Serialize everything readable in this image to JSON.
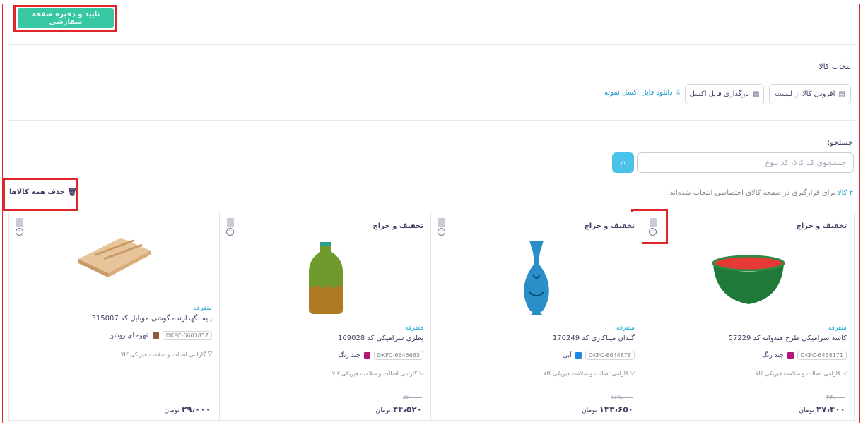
{
  "toolbar": {
    "save_label": "تایید و ذخیره صفحه سفارشی"
  },
  "select_section": {
    "title": "انتخاب کالا",
    "add_from_list": "افزودن کالا از لیست",
    "upload_excel": "بارگذاری فایل اکسل",
    "download_sample": "دانلود فایل اکسل نمونه"
  },
  "search": {
    "label": "جستجو:",
    "placeholder": "جستجوی کد کالا، کد تنوع"
  },
  "list_header": {
    "count": "۴ کالا",
    "count_text": "برای قرارگیری در صفحه کالای اختصاصی انتخاب شده‌اند.",
    "delete_all": "حذف همه کالاها"
  },
  "products": [
    {
      "badge": "تخفیف و حراج",
      "category": "متفرقه",
      "title": "کاسه سرامیکی طرح هندوانه کد 57229",
      "dkpc": "DKPC-6458171",
      "color_name": "چند رنگ",
      "color": "#b5157a",
      "guarantee": "گارانتی اصالت و سلامت فیزیکی کالا",
      "old_price": "۴۴،۰۰۰",
      "price": "۳۷،۴۰۰",
      "currency": "تومان"
    },
    {
      "badge": "تخفیف و حراج",
      "category": "متفرقه",
      "title": "گلدان میناکاری کد 170249",
      "dkpc": "DKPC-6644878",
      "color_name": "آبی",
      "color": "#1e88e5",
      "guarantee": "گارانتی اصالت و سلامت فیزیکی کالا",
      "old_price": "۱۶۹،۰۰۰",
      "price": "۱۴۳،۶۵۰",
      "currency": "تومان"
    },
    {
      "badge": "تخفیف و حراج",
      "category": "متفرقه",
      "title": "بطری سرامیکی کد 169028",
      "dkpc": "DKPC-6645663",
      "color_name": "چند رنگ",
      "color": "#b5157a",
      "guarantee": "گارانتی اصالت و سلامت فیزیکی کالا",
      "old_price": "۵۲،۰۰۰",
      "price": "۴۴،۵۲۰",
      "currency": "تومان"
    },
    {
      "badge": "",
      "category": "متفرقه",
      "title": "پایه نگهدارنده گوشی موبایل کد 315007",
      "dkpc": "DKPC-6603857",
      "color_name": "قهوه ای روشن",
      "color": "#8d5a3b",
      "guarantee": "گارانتی اصالت و سلامت فیزیکی کالا",
      "old_price": "",
      "price": "۲۹،۰۰۰",
      "currency": "تومان"
    }
  ],
  "colors": {
    "accent_green": "#37c7a2",
    "accent_blue": "#4bc3e9",
    "link_blue": "#1b9ad3",
    "highlight_red": "#e0242b"
  }
}
